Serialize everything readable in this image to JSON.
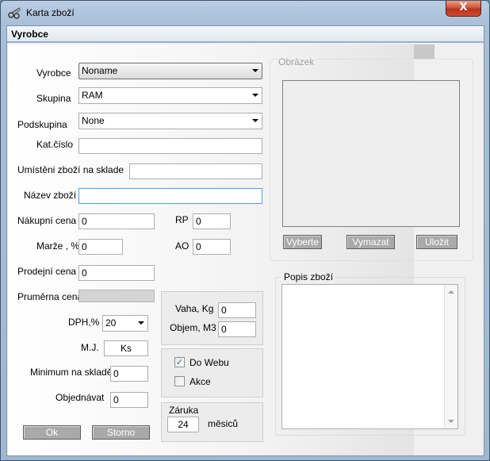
{
  "window": {
    "title": "Karta zboží",
    "close_symbol": "X"
  },
  "group": {
    "title": "Vyrobce"
  },
  "form": {
    "vyrobce_label": "Vyrobce",
    "vyrobce_value": "Noname",
    "skupina_label": "Skupina",
    "skupina_value": "RAM",
    "podskupina_label": "Podskupina",
    "podskupina_value": "None",
    "kat_cislo_label": "Kat.číslo",
    "kat_cislo_value": "",
    "umisteni_label": "Umístěni zboží na sklade",
    "umisteni_value": "",
    "nazev_label": "Název zboží",
    "nazev_value": "",
    "nakupni_cena_label": "Nákupní cena",
    "nakupni_cena_value": "0",
    "rp_label": "RP",
    "rp_value": "0",
    "marze_label": "Marže , %",
    "marze_value": "0",
    "ao_label": "AO",
    "ao_value": "0",
    "prodejni_cena_label": "Prodejní cena",
    "prodejni_cena_value": "0",
    "prumerna_cena_label": "Pruměrna cena",
    "prumerna_cena_value": "",
    "dph_label": "DPH,%",
    "dph_value": "20",
    "mj_label": "M.J.",
    "mj_value": "Ks",
    "minimum_label": "Minimum na skladě",
    "minimum_value": "0",
    "objednavat_label": "Objednávat",
    "objednavat_value": "0"
  },
  "weights": {
    "vaha_label": "Vaha, Kg",
    "vaha_value": "0",
    "objem_label": "Objem, M3",
    "objem_value": "0"
  },
  "flags": {
    "do_webu_label": "Do Webu",
    "do_webu_checked": true,
    "akce_label": "Akce",
    "akce_checked": false
  },
  "warranty": {
    "title": "Záruka",
    "value": "24",
    "unit": "měsiců"
  },
  "image_group": {
    "title": "Obrázek",
    "select_button": "Vyberte",
    "delete_button": "Vymazat",
    "save_button": "Uložit"
  },
  "description": {
    "title": "Popis zboží",
    "value": ""
  },
  "footer": {
    "ok_button": "Ok",
    "cancel_button": "Storno"
  },
  "check_mark": "✓"
}
